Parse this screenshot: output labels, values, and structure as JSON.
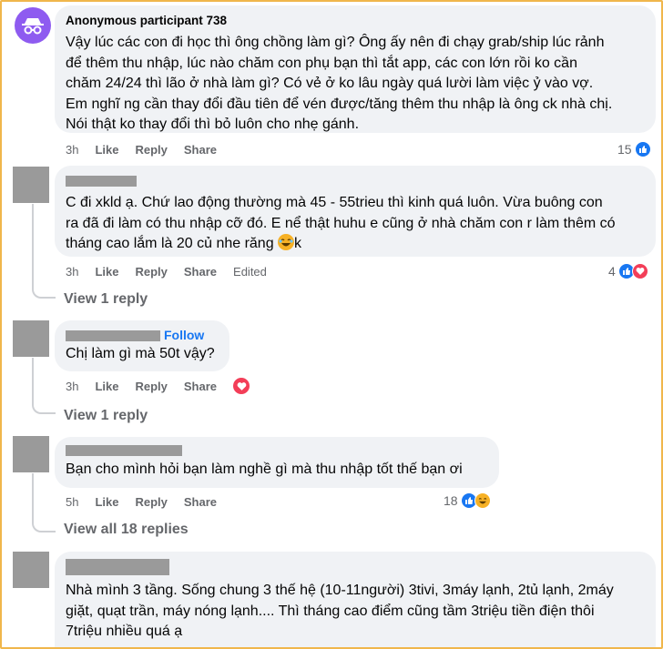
{
  "comments": [
    {
      "author": "Anonymous participant 738",
      "text": "Vậy lúc các con đi học thì ông chồng làm gì? Ông ấy nên đi chạy grab/ship lúc rảnh\nđể thêm thu nhập, lúc nào chăm con phụ bạn thì tắt app, các con lớn rồi ko cần\nchăm 24/24 thì lão ở nhà làm gì? Có vẻ ở ko lâu ngày quá lười làm việc ỷ vào vợ.\nEm nghĩ ng cần thay đổi đầu tiên để vén được/tăng thêm thu nhập là ông ck nhà chị.\nNói thật ko thay đổi thì bỏ luôn cho nhẹ gánh.",
      "time": "3h",
      "like": "Like",
      "reply": "Reply",
      "share": "Share",
      "reactions": "15"
    },
    {
      "text_pre": "C đi xkld ạ. Chứ lao động thường mà 45 - 55trieu thì kinh quá luôn. Vừa buông con\nra đã đi làm có thu nhập cỡ đó. E nể thật huhu e cũng ở nhà chăm con r làm thêm có\ntháng cao lắm là 20 củ nhe răng ",
      "text_post": "k",
      "time": "3h",
      "like": "Like",
      "reply": "Reply",
      "share": "Share",
      "edited": "Edited",
      "reactions": "4",
      "view_replies": "View 1 reply"
    },
    {
      "follow": "Follow",
      "text": "Chị làm gì mà 50t vậy?",
      "time": "3h",
      "like": "Like",
      "reply": "Reply",
      "share": "Share",
      "view_replies": "View 1 reply"
    },
    {
      "text": "Bạn cho mình hỏi bạn làm nghề gì mà thu nhập tốt thế bạn ơi",
      "time": "5h",
      "like": "Like",
      "reply": "Reply",
      "share": "Share",
      "reactions": "18",
      "view_replies": "View all 18 replies"
    },
    {
      "text": "Nhà mình 3 tầng. Sống chung 3 thế hệ (10-11người) 3tivi, 3máy lạnh, 2tủ lạnh, 2máy\ngiặt, quạt trần, máy nóng lạnh.... Thì tháng cao điểm cũng tầm 3triệu tiền điện thôi\n7triệu nhiều quá ạ"
    }
  ],
  "colors": {
    "like": "#1877f2",
    "love": "#f33e58",
    "haha": "#f7b125",
    "border": "#f0b64b"
  }
}
